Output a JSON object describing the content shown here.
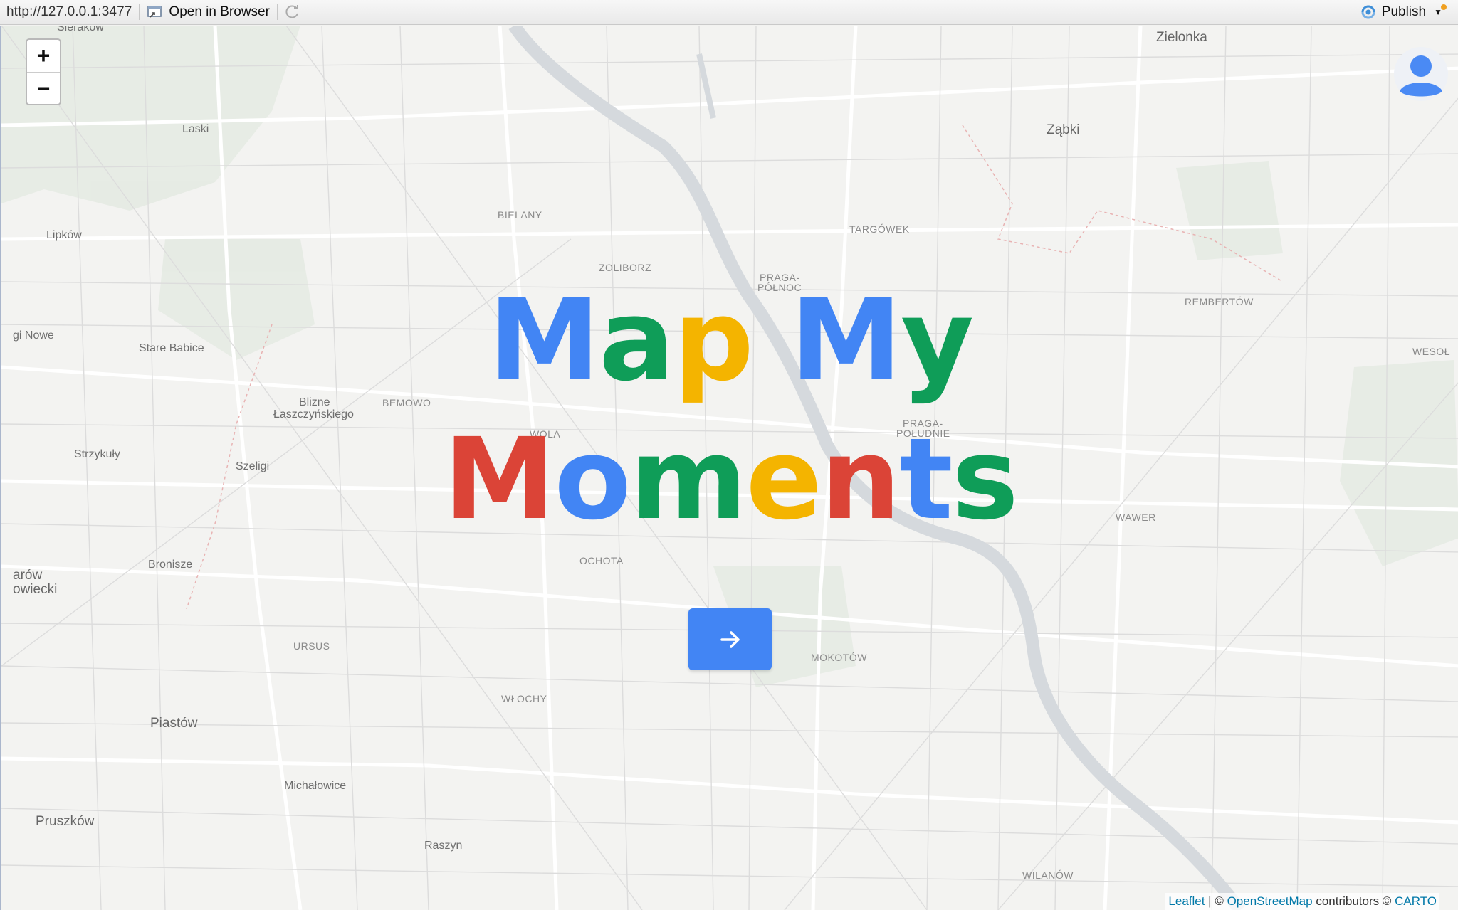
{
  "toolbar": {
    "url": "http://127.0.0.1:3477",
    "open_in_browser": "Open in Browser",
    "publish": "Publish"
  },
  "map": {
    "zoom_in": "+",
    "zoom_out": "−",
    "places": {
      "sierakow": "Sieraków",
      "zielonka": "Zielonka",
      "laski": "Laski",
      "zabki": "Ząbki",
      "bielany": "BIELANY",
      "targowek": "TARGÓWEK",
      "lipkow": "Lipków",
      "zoliborz": "ŻOLIBORZ",
      "praga_polnoc_1": "PRAGA-",
      "praga_polnoc_2": "PÓŁNOC",
      "rembertow": "REMBERTÓW",
      "gi_nowe": "gi Nowe",
      "stare_babice": "Stare Babice",
      "wesola": "WESOŁ",
      "blizne_1": "Blizne",
      "blizne_2": "Łaszczyńskiego",
      "bemowo": "BEMOWO",
      "wola": "WOLA",
      "praga_poludnie_1": "PRAGA-",
      "praga_poludnie_2": "POŁUDNIE",
      "strzykuly": "Strzykuły",
      "szeligi": "Szeligi",
      "wawer": "WAWER",
      "ozarow_1": "arów",
      "ozarow_2": "owiecki",
      "bronisze": "Bronisze",
      "ochota": "OCHOTA",
      "ursus": "URSUS",
      "mokotow": "MOKOTÓW",
      "wlochy": "WŁOCHY",
      "piastow": "Piastów",
      "michalowice": "Michałowice",
      "pruszkow": "Pruszków",
      "raszyn": "Raszyn",
      "wilanow": "WILANÓW"
    }
  },
  "hero": {
    "title_line1": [
      "M",
      "a",
      "p",
      " ",
      "M",
      "y"
    ],
    "title_line2": [
      "M",
      "o",
      "m",
      "e",
      "n",
      "t",
      "s"
    ],
    "colors_line1": [
      "#4285f4",
      "#0f9d58",
      "#f4b400",
      "#4285f4",
      "#4285f4",
      "#0f9d58"
    ],
    "colors_line2": [
      "#db4437",
      "#4285f4",
      "#0f9d58",
      "#f4b400",
      "#db4437",
      "#4285f4",
      "#0f9d58"
    ]
  },
  "go_button_icon": "arrow-right-icon",
  "attribution": {
    "leaflet": "Leaflet",
    "sep1": " | © ",
    "osm": "OpenStreetMap",
    "mid": " contributors © ",
    "carto": "CARTO"
  }
}
